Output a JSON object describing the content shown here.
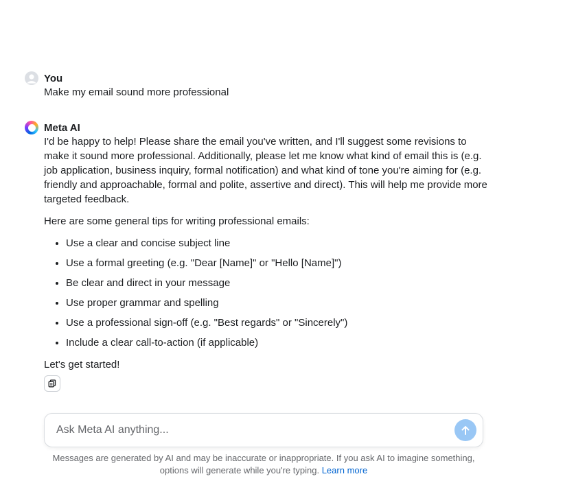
{
  "conversation": {
    "user_message": {
      "author": "You",
      "text": "Make my email sound more professional"
    },
    "bot_message": {
      "author": "Meta AI",
      "intro": "I'd be happy to help! Please share the email you've written, and I'll suggest some revisions to make it sound more professional. Additionally, please let me know what kind of email this is (e.g. job application, business inquiry, formal notification) and what kind of tone you're aiming for (e.g. friendly and approachable, formal and polite, assertive and direct). This will help me provide more targeted feedback.",
      "tips_lead": "Here are some general tips for writing professional emails:",
      "tips": [
        "Use a clear and concise subject line",
        "Use a formal greeting (e.g. \"Dear [Name]\" or \"Hello [Name]\")",
        "Be clear and direct in your message",
        "Use proper grammar and spelling",
        "Use a professional sign-off (e.g. \"Best regards\" or \"Sincerely\")",
        "Include a clear call-to-action (if applicable)"
      ],
      "closing": "Let's get started!"
    }
  },
  "composer": {
    "placeholder": "Ask Meta AI anything...",
    "value": ""
  },
  "disclaimer": {
    "text": "Messages are generated by AI and may be inaccurate or inappropriate. If you ask AI to imagine something, options will generate while you're typing.",
    "link_label": "Learn more"
  },
  "icons": {
    "user_avatar": "person-avatar-icon",
    "bot_avatar": "meta-ai-ring-icon",
    "copy": "copy-icon",
    "send": "arrow-up-icon"
  },
  "colors": {
    "send_button": "#99c7f5",
    "link": "#0064d1",
    "text": "#1c1e21",
    "muted": "#65676b"
  }
}
